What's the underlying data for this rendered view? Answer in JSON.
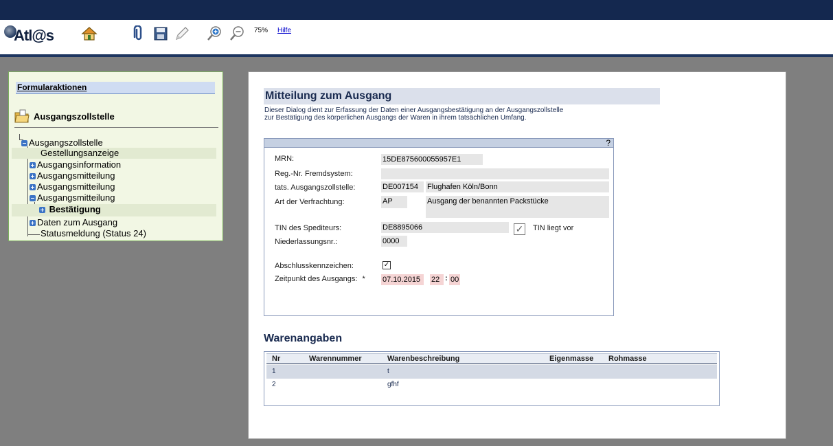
{
  "toolbar": {
    "logo_text": "Atl@s",
    "zoom_label": "75%",
    "help_label": "Hilfe"
  },
  "left_panel": {
    "title": "Formularaktionen",
    "folder_label": "Ausgangszollstelle",
    "tree": [
      {
        "label": "Ausgangszollstelle"
      },
      {
        "label": "Gestellungsanzeige"
      },
      {
        "label": "Ausgangsinformation"
      },
      {
        "label": "Ausgangsmitteilung"
      },
      {
        "label": "Ausgangsmitteilung"
      },
      {
        "label": "Ausgangsmitteilung"
      },
      {
        "label": "Bestätigung"
      },
      {
        "label": "Daten zum Ausgang"
      },
      {
        "label": "Statusmeldung (Status 24)"
      }
    ]
  },
  "form": {
    "title": "Mitteilung zum Ausgang",
    "description": "Dieser Dialog dient zur Erfassung der Daten einer Ausgangsbestätigung an der Ausgangszollstelle zur Bestätigung des körperlichen Ausgangs der Waren in ihrem tatsächlichen Umfang.",
    "help_mark": "?",
    "fields": {
      "mrn_label": "MRN:",
      "mrn_value": "15DE875600055957E1",
      "reg_label": "Reg.-Nr. Fremdsystem:",
      "reg_value": "",
      "office_label": "tats. Ausgangszollstelle:",
      "office_code": "DE007154",
      "office_name": "Flughafen Köln/Bonn",
      "freight_label": "Art der Verfrachtung:",
      "freight_code": "AP",
      "freight_desc": "Ausgang der benannten Packstücke",
      "tin_label": "TIN des Spediteurs:",
      "tin_value": "DE8895066",
      "tin_check_label": "TIN liegt vor",
      "branch_label": "Niederlassungsnr.:",
      "branch_value": "0000",
      "closing_label": "Abschlusskennzeichen:",
      "time_label": "Zeitpunkt des Ausgangs:",
      "time_required": "*",
      "date_value": "07.10.2015",
      "hour_value": "22",
      "time_sep": ":",
      "minute_value": "00"
    }
  },
  "goods": {
    "title": "Warenangaben",
    "columns": [
      "Nr",
      "Warennummer",
      "Warenbeschreibung",
      "Eigenmasse",
      "Rohmasse"
    ],
    "rows": [
      {
        "nr": "1",
        "number": "",
        "desc": "t",
        "own": "",
        "gross": ""
      },
      {
        "nr": "2",
        "number": "",
        "desc": "gfhf",
        "own": "",
        "gross": ""
      }
    ]
  },
  "colors": {
    "topbar": "#14284f",
    "panel_bg": "#f2f7e4",
    "panel_border": "#7bb25c",
    "workspace": "#7f7f7f",
    "required_field": "#f5d4d4"
  }
}
